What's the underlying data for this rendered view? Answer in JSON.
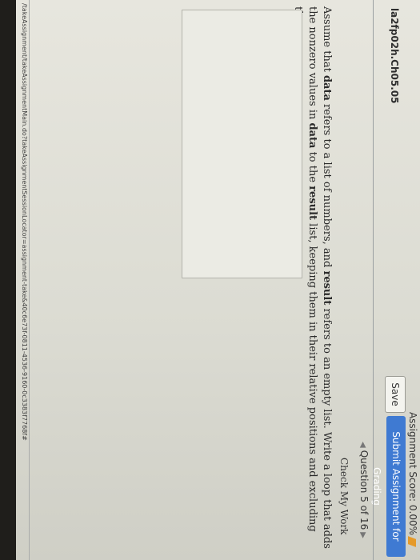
{
  "header": {
    "score_label": "Assignment Score: 0.00%",
    "save_label": "Save",
    "submit_label": "Submit Assignment for Grading",
    "assignment_title": "la2fp02h.Ch05.05"
  },
  "nav": {
    "question_position": "Question 5 of 16"
  },
  "question": {
    "check_label": "Check My Work",
    "text": {
      "t1": "Assume that ",
      "b1": "data",
      "t2": " refers to a list of numbers, and ",
      "b2": "result",
      "t3": " refers to an empty list. Write a loop that adds the nonzero values in ",
      "b3": "data",
      "t4": " to the ",
      "b4": "result",
      "t5": " list, keeping them in their relative positions and excluding the zeros."
    },
    "answer_value": ""
  },
  "status_bar": {
    "url": "/takeAssignment/takeAssignmentMain.do?takeAssignmentSessionLocator=assignment-take&40c6e73f-0811-4536-9160-0c3383f7768f#"
  }
}
